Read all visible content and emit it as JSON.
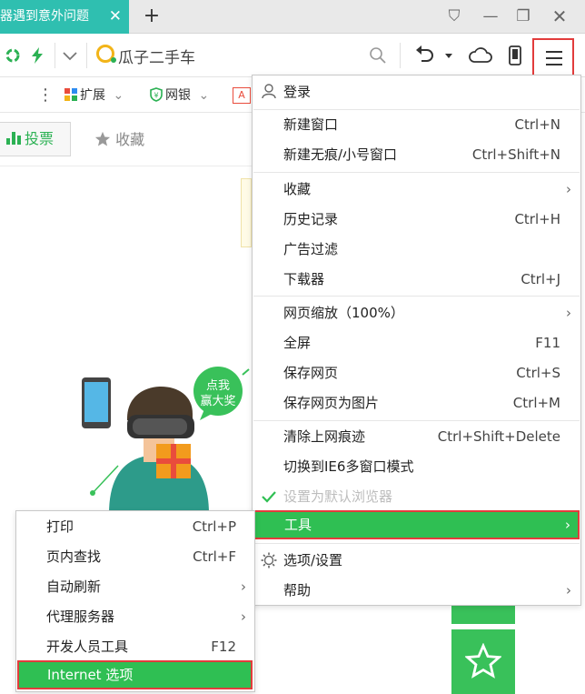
{
  "tab": {
    "title": "览器遇到意外问题",
    "close_glyph": "✕"
  },
  "tabstrip": {
    "new_tab_glyph": "+"
  },
  "window": {
    "skin_glyph": "⛉",
    "minimize_glyph": "—",
    "restore_glyph": "❐",
    "close_glyph": "✕"
  },
  "addressbar": {
    "value": "瓜子二手车"
  },
  "bookmarks": {
    "more_glyph": "⋮",
    "extensions_label": "扩展",
    "bank_label": "网银",
    "chevron": "⌄"
  },
  "content": {
    "vote_label": "投票",
    "favorite_label": "收藏",
    "promo_badge_line1": "点我",
    "promo_badge_line2": "赢大奖"
  },
  "main_menu": {
    "login": "登录",
    "new_window": {
      "label": "新建窗口",
      "shortcut": "Ctrl+N"
    },
    "new_private": {
      "label": "新建无痕/小号窗口",
      "shortcut": "Ctrl+Shift+N"
    },
    "favorites": {
      "label": "收藏"
    },
    "history": {
      "label": "历史记录",
      "shortcut": "Ctrl+H"
    },
    "ad_filter": {
      "label": "广告过滤"
    },
    "downloads": {
      "label": "下载器",
      "shortcut": "Ctrl+J"
    },
    "zoom": {
      "label": "网页缩放（100%）"
    },
    "fullscreen": {
      "label": "全屏",
      "shortcut": "F11"
    },
    "save_page": {
      "label": "保存网页",
      "shortcut": "Ctrl+S"
    },
    "save_as_image": {
      "label": "保存网页为图片",
      "shortcut": "Ctrl+M"
    },
    "clear_traces": {
      "label": "清除上网痕迹",
      "shortcut": "Ctrl+Shift+Delete"
    },
    "ie6_mode": {
      "label": "切换到IE6多窗口模式"
    },
    "set_default": {
      "label": "设置为默认浏览器"
    },
    "tools": {
      "label": "工具"
    },
    "options": {
      "label": "选项/设置"
    },
    "help": {
      "label": "帮助"
    },
    "submenu_arrow": "›"
  },
  "tools_menu": {
    "print": {
      "label": "打印",
      "shortcut": "Ctrl+P"
    },
    "find": {
      "label": "页内查找",
      "shortcut": "Ctrl+F"
    },
    "auto_refresh": {
      "label": "自动刷新"
    },
    "proxy": {
      "label": "代理服务器"
    },
    "devtools": {
      "label": "开发人员工具",
      "shortcut": "F12"
    },
    "internet_options": {
      "label": "Internet 选项"
    }
  },
  "colors": {
    "accent_green": "#2fbf53",
    "tab_teal": "#2fbfb0",
    "highlight_outline": "#e23c3c"
  }
}
